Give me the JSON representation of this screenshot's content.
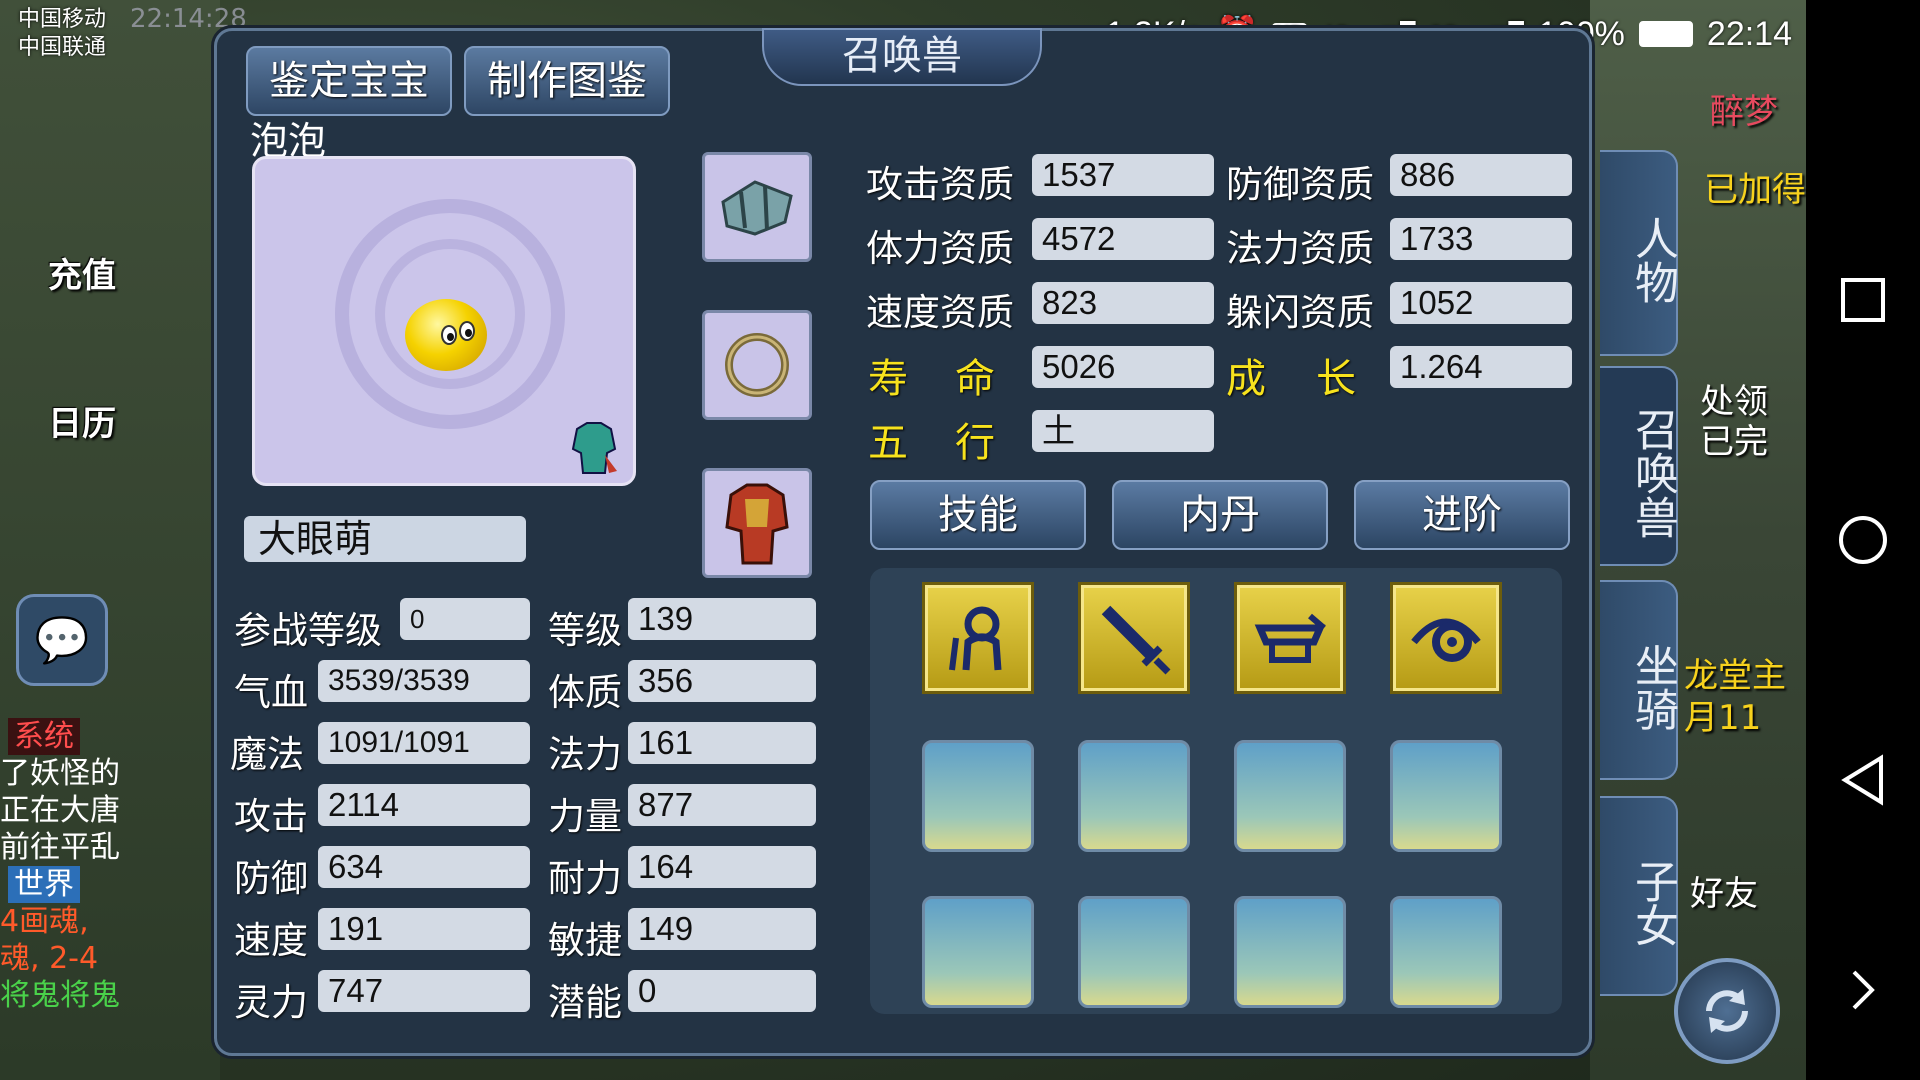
{
  "status_bar": {
    "carrier1": "中国移动",
    "carrier2": "中国联通",
    "faded_time": "22:14:28",
    "net_speed": "1.2K/s",
    "battery": "100%",
    "time": "22:14",
    "signal1": "4G",
    "signal2": "2G"
  },
  "hud_left": {
    "recharge": "充值",
    "calendar": "日历",
    "chat_tag_system": "系统",
    "chat_line1": "了妖怪的",
    "chat_line2": "正在大唐",
    "chat_line3": "前往平乱",
    "chat_tag_world": "世界",
    "chat_line4": "4画魂,",
    "chat_line5": "魂, 2-4",
    "chat_line6": "将鬼将鬼"
  },
  "hud_right": {
    "text1": "醉梦",
    "text2": "已加得",
    "text3": "处领",
    "text4": "已完",
    "text5": "龙堂主",
    "text6": "月11",
    "friends": "好友"
  },
  "panel": {
    "title": "召唤兽",
    "tab_identify": "鉴定宝宝",
    "tab_catalog": "制作图鉴",
    "pet_name": "泡泡",
    "pet_species": "大眼萌"
  },
  "aptitudes": {
    "attack_label": "攻击资质",
    "attack": "1537",
    "defense_label": "防御资质",
    "defense": "886",
    "hp_label": "体力资质",
    "hp": "4572",
    "magic_label": "法力资质",
    "magic": "1733",
    "speed_label": "速度资质",
    "speed": "823",
    "dodge_label": "躲闪资质",
    "dodge": "1052",
    "life_label1": "寿",
    "life_label2": "命",
    "life": "5026",
    "growth_label1": "成",
    "growth_label2": "长",
    "growth": "1.264",
    "element_label1": "五",
    "element_label2": "行",
    "element": "土"
  },
  "actions": {
    "skills": "技能",
    "inner_dan": "内丹",
    "advance": "进阶"
  },
  "stats": {
    "battle_level_label": "参战等级",
    "battle_level": "0",
    "level_label": "等级",
    "level": "139",
    "hp_label": "气血",
    "hp": "3539/3539",
    "con_label": "体质",
    "con": "356",
    "mp_label": "魔法",
    "mp": "1091/1091",
    "mag_label": "法力",
    "mag": "161",
    "atk_label": "攻击",
    "atk": "2114",
    "str_label": "力量",
    "str": "877",
    "def_label": "防御",
    "def": "634",
    "end_label": "耐力",
    "end": "164",
    "spd_label": "速度",
    "spd": "191",
    "agi_label": "敏捷",
    "agi": "149",
    "spi_label": "灵力",
    "spi": "747",
    "pot_label": "潜能",
    "pot": "0"
  },
  "side_tabs": {
    "character": "人物",
    "summon": "召唤兽",
    "mount": "坐骑",
    "children": "子女"
  },
  "skill_icons": [
    "summon-figure-icon",
    "sword-icon",
    "mouth-jaw-icon",
    "eye-icon"
  ],
  "colors": {
    "panel_bg": "#233344",
    "yellow_label": "#f7e21d",
    "skill_gold": "#e8d24a"
  }
}
